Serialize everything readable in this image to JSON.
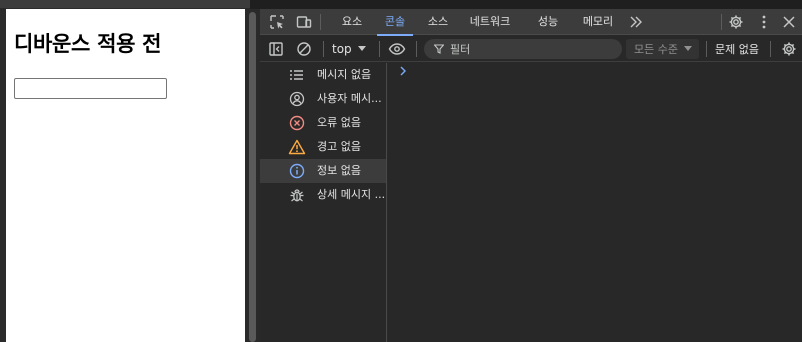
{
  "webpage": {
    "heading": "디바운스 적용 전",
    "input_value": ""
  },
  "devtools": {
    "tabs": [
      {
        "label": "요소",
        "active": false
      },
      {
        "label": "콘솔",
        "active": true
      },
      {
        "label": "소스",
        "active": false
      },
      {
        "label": "네트워크",
        "active": false
      },
      {
        "label": "성능",
        "active": false
      },
      {
        "label": "메모리",
        "active": false
      }
    ],
    "more_tabs_icon": "double-chevron-right",
    "toolbar": {
      "context": "top",
      "filter_placeholder": "필터",
      "log_level": "모든 수준",
      "issues": "문제 없음"
    },
    "sidebar": [
      {
        "label": "메시지 없음",
        "icon": "list-icon"
      },
      {
        "label": "사용자 메시...",
        "icon": "user-icon"
      },
      {
        "label": "오류 없음",
        "icon": "error-icon"
      },
      {
        "label": "경고 없음",
        "icon": "warning-icon"
      },
      {
        "label": "정보 없음",
        "icon": "info-icon",
        "selected": true
      },
      {
        "label": "상세 메시지 ...",
        "icon": "bug-icon"
      }
    ],
    "colors": {
      "accent": "#7cacf8",
      "error": "#f28b82",
      "warning": "#fdab40",
      "info": "#7cacf8"
    }
  }
}
